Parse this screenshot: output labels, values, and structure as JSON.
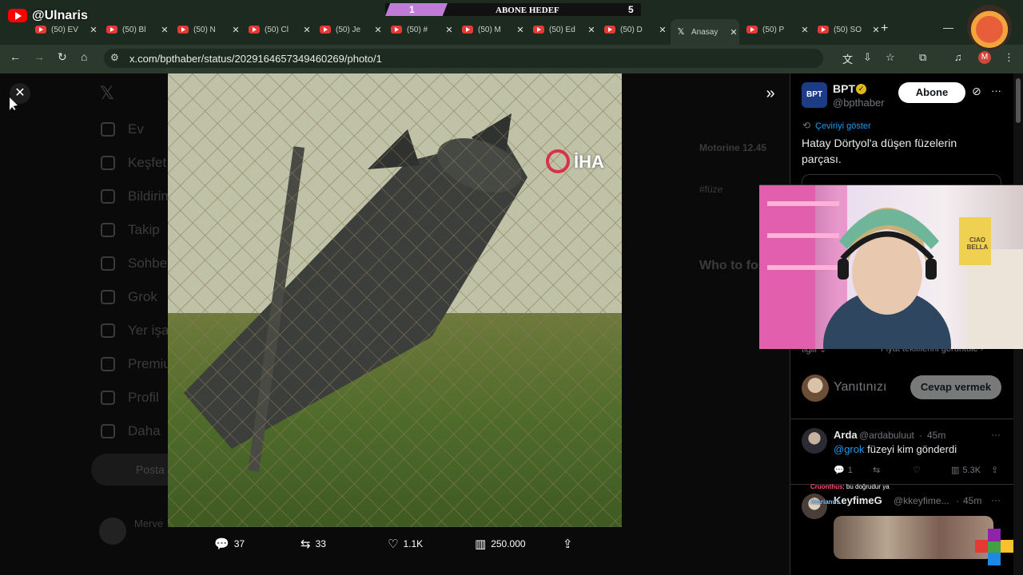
{
  "overlay": {
    "channel_handle": "@Ulnaris",
    "goal_label": "ABONE HEDEF",
    "goal_current": "1",
    "goal_target": "5"
  },
  "browser": {
    "tabs": [
      {
        "label": "(50) EV",
        "type": "youtube"
      },
      {
        "label": "(50) Bl",
        "type": "youtube"
      },
      {
        "label": "(50) N",
        "type": "youtube"
      },
      {
        "label": "(50) Cl",
        "type": "youtube"
      },
      {
        "label": "(50) Je",
        "type": "youtube"
      },
      {
        "label": "(50) #",
        "type": "youtube"
      },
      {
        "label": "(50) M",
        "type": "youtube"
      },
      {
        "label": "(50) Ed",
        "type": "youtube"
      },
      {
        "label": "(50) D",
        "type": "youtube"
      },
      {
        "label": "Anasay",
        "type": "x",
        "active": true
      },
      {
        "label": "(50) P",
        "type": "youtube"
      },
      {
        "label": "(50) SO",
        "type": "youtube"
      }
    ],
    "url": "x.com/bpthaber/status/2029164657349460269/photo/1",
    "profile_initial": "M"
  },
  "x_background": {
    "nav": [
      "Ev",
      "Keşfet",
      "Bildirimler",
      "Takip",
      "Sohbet",
      "Grok",
      "Yer işaretleri",
      "Premium",
      "Profil",
      "Daha"
    ],
    "post_label": "Posta",
    "user_name": "Merve",
    "right_items": [
      "Motorine 12.45",
      "#füze",
      "Who to follow"
    ]
  },
  "media": {
    "watermark": "İHA",
    "replies": "37",
    "reposts": "33",
    "likes": "1.1K",
    "views": "250.000"
  },
  "tweet": {
    "account_name": "BPT",
    "account_handle": "@bpthaber",
    "avatar_text": "BPT",
    "follow_label": "Abone",
    "translate_label": "Çeviriyi göster",
    "text": "Hatay Dörtyol'a düşen füzelerin parçası.",
    "relevant_label": "İlgili",
    "quote_label": "Fiyat tekliflerini görüntüle",
    "reply_placeholder": "Yanıtınızı",
    "reply_button": "Cevap vermek"
  },
  "replies": [
    {
      "name": "Arda",
      "handle": "@ardabuluut",
      "time": "45m",
      "mention": "@grok",
      "text": " füzeyi kim gönderdi",
      "replies": "1",
      "views": "5.3K"
    },
    {
      "name": "KeyfimeG",
      "handle": "@kkeyfime...",
      "time": "45m"
    }
  ],
  "chat": {
    "line1_user": "Cruonthus",
    "line1_text": ": bu doğrudur ya",
    "line2_user": "Atarianus"
  },
  "webcam": {
    "pillow_text": "CIAO BELLA"
  },
  "colors": {
    "x_blue": "#1d9bf0",
    "chrome_dark": "#1d2a1f",
    "chrome_mid": "#2c3a2e",
    "youtube_red": "#ff0000",
    "goal_purple": "#c07ad8",
    "verified_gold": "#e2b719"
  }
}
